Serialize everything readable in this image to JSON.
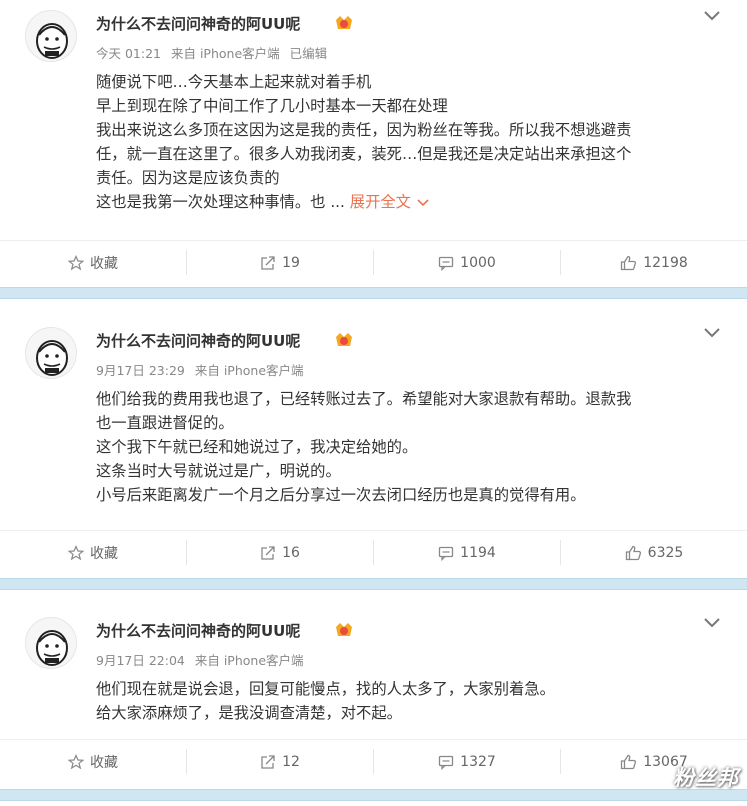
{
  "posts": [
    {
      "username": "为什么不去问问神奇的阿UU呢",
      "time": "今天 01:21",
      "source": "来自 iPhone客户端",
      "edited": "已编辑",
      "lines": [
        "随便说下吧…今天基本上起来就对着手机",
        "早上到现在除了中间工作了几小时基本一天都在处理",
        "我出来说这么多顶在这因为这是我的责任，因为粉丝在等我。所以我不想逃避责",
        "任，就一直在这里了。很多人劝我闭麦，装死…但是我还是决定站出来承担这个",
        "责任。因为这是应该负责的",
        "这也是我第一次处理这种事情。也 ... "
      ],
      "expand_label": "展开全文",
      "actions": {
        "favorite": "收藏",
        "repost": "19",
        "comment": "1000",
        "like": "12198"
      }
    },
    {
      "username": "为什么不去问问神奇的阿UU呢",
      "time": "9月17日 23:29",
      "source": "来自 iPhone客户端",
      "lines": [
        "他们给我的费用我也退了，已经转账过去了。希望能对大家退款有帮助。退款我",
        "也一直跟进督促的。",
        "这个我下午就已经和她说过了，我决定给她的。",
        "这条当时大号就说过是广，明说的。",
        "小号后来距离发广一个月之后分享过一次去闭口经历也是真的觉得有用。"
      ],
      "actions": {
        "favorite": "收藏",
        "repost": "16",
        "comment": "1194",
        "like": "6325"
      }
    },
    {
      "username": "为什么不去问问神奇的阿UU呢",
      "time": "9月17日 22:04",
      "source": "来自 iPhone客户端",
      "lines": [
        "他们现在就是说会退，回复可能慢点，找的人太多了，大家别着急。",
        "给大家添麻烦了，是我没调查清楚，对不起。"
      ],
      "actions": {
        "favorite": "收藏",
        "repost": "12",
        "comment": "1327",
        "like": "13067"
      }
    }
  ],
  "watermark": "粉丝邦",
  "icons": [
    "avatar",
    "vip-badge-icon",
    "chevron-down-icon",
    "star-icon",
    "repost-icon",
    "comment-icon",
    "thumbs-up-icon"
  ],
  "colors": {
    "accent": "#eb7350",
    "separator": "#d0e6f2",
    "meta_text": "#888888"
  }
}
